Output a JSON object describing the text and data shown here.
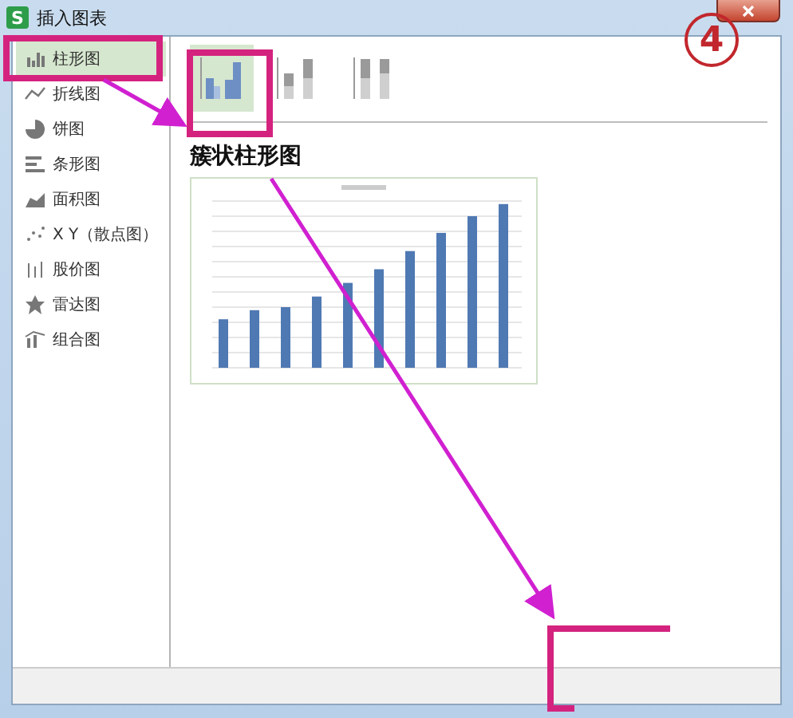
{
  "window": {
    "title": "插入图表",
    "app_icon": "S"
  },
  "sidebar": {
    "items": [
      {
        "label": "柱形图",
        "selected": true
      },
      {
        "label": "折线图",
        "selected": false
      },
      {
        "label": "饼图",
        "selected": false
      },
      {
        "label": "条形图",
        "selected": false
      },
      {
        "label": "面积图",
        "selected": false
      },
      {
        "label": "X Y（散点图）",
        "selected": false
      },
      {
        "label": "股价图",
        "selected": false
      },
      {
        "label": "雷达图",
        "selected": false
      },
      {
        "label": "组合图",
        "selected": false
      }
    ]
  },
  "subtypes": [
    {
      "kind": "clustered",
      "selected": true
    },
    {
      "kind": "stacked",
      "selected": false
    },
    {
      "kind": "percent",
      "selected": false
    }
  ],
  "preview": {
    "heading": "簇状柱形图"
  },
  "annotation": {
    "step": "4"
  }
}
